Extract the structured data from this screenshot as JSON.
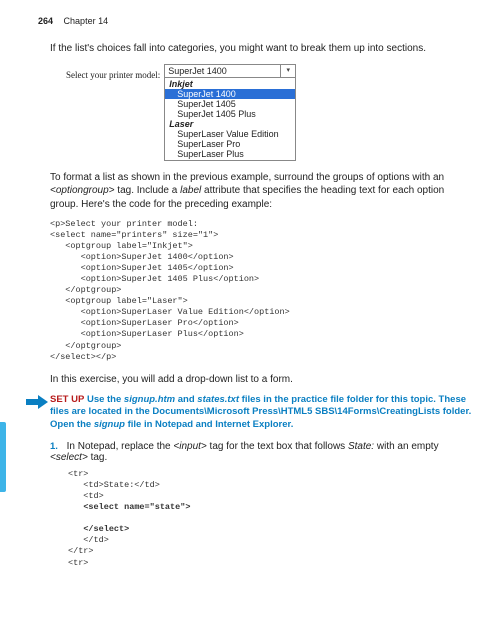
{
  "header": {
    "page": "264",
    "chapter": "Chapter",
    "chnum": "14"
  },
  "p1": "If the list's choices fall into categories, you might want to break them up into sections.",
  "figLabel": "Select your printer model:",
  "dropdown": {
    "display": "SuperJet 1400",
    "g1": "Inkjet",
    "o1": "SuperJet 1400",
    "o2": "SuperJet 1405",
    "o3": "SuperJet 1405 Plus",
    "g2": "Laser",
    "o4": "SuperLaser Value Edition",
    "o5": "SuperLaser Pro",
    "o6": "SuperLaser Plus"
  },
  "p2a": "To format a list as shown in the previous example, surround the groups of options with an ",
  "p2tag": "<optiongroup>",
  "p2b": " tag. Include a ",
  "p2attr": "label",
  "p2c": " attribute that specifies the heading text for each option group. Here's the code for the preceding example:",
  "code1": "<p>Select your printer model:\n<select name=\"printers\" size=\"1\">\n   <optgroup label=\"Inkjet\">\n      <option>SuperJet 1400</option>\n      <option>SuperJet 1405</option>\n      <option>SuperJet 1405 Plus</option>\n   </optgroup>\n   <optgroup label=\"Laser\">\n      <option>SuperLaser Value Edition</option>\n      <option>SuperLaser Pro</option>\n      <option>SuperLaser Plus</option>\n   </optgroup>\n</select></p>",
  "p3": "In this exercise, you will add a drop-down list to a form.",
  "setup": {
    "label": "SET UP",
    "a": "Use the ",
    "f1": "signup.htm",
    "b": " and ",
    "f2": "states.txt",
    "c": " files in the practice file folder for this topic. These files are located in the Documents\\Microsoft Press\\HTML5 SBS\\14Forms\\CreatingLists folder. Open the ",
    "f3": "signup",
    "d": " file in Notepad and Internet Explorer."
  },
  "step1": {
    "num": "1.",
    "a": "In Notepad, replace the ",
    "tag": "<input>",
    "b": " tag for the text box that follows ",
    "state": "State:",
    "c": " with an empty ",
    "sel": "<select>",
    "d": " tag."
  },
  "code2a": "<tr>\n   <td>State:</td>\n   <td>\n   ",
  "code2bold1": "<select name=\"state\">",
  "code2mid": "\n\n   ",
  "code2bold2": "</select>",
  "code2b": "\n   </td>\n</tr>\n<tr>"
}
